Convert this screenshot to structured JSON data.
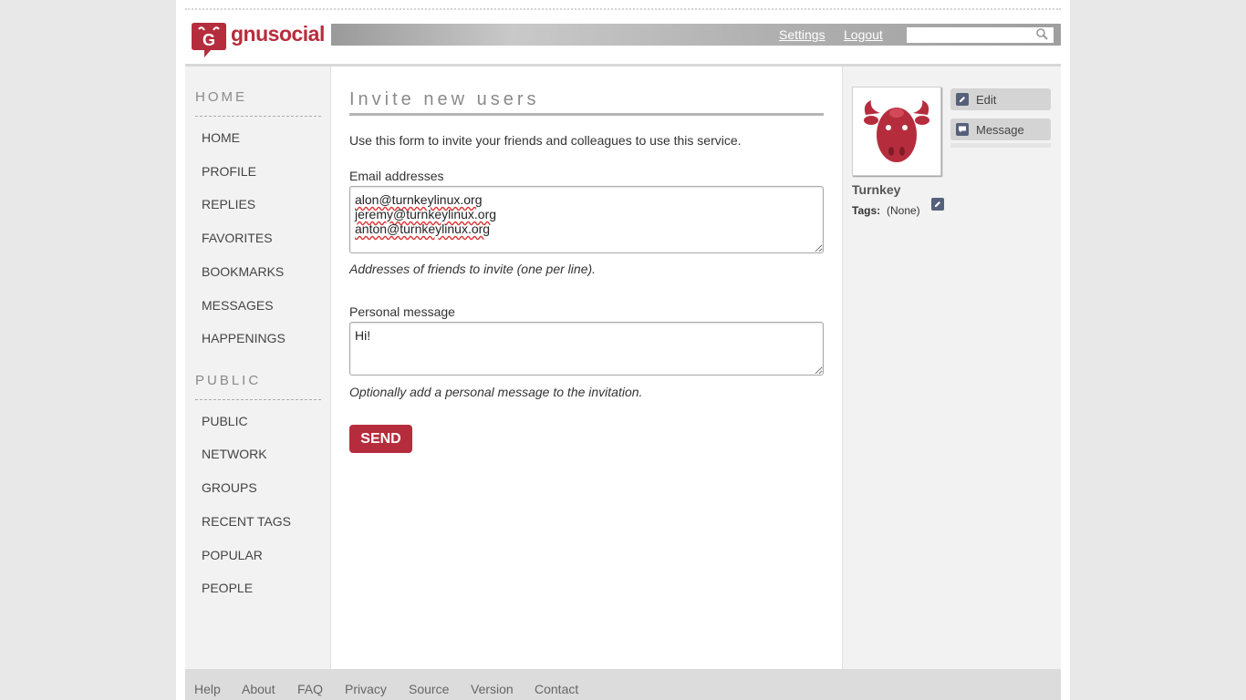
{
  "brand": {
    "logo_text": "gnusocial",
    "accent": "#b52d3d"
  },
  "header": {
    "settings_label": "Settings",
    "logout_label": "Logout",
    "search_placeholder": "",
    "search_icon": "magnifier-icon"
  },
  "sidebar": {
    "home_section": "HOME",
    "home_items": [
      "HOME",
      "PROFILE",
      "REPLIES",
      "FAVORITES",
      "BOOKMARKS",
      "MESSAGES",
      "HAPPENINGS"
    ],
    "public_section": "PUBLIC",
    "public_items": [
      "PUBLIC",
      "NETWORK",
      "GROUPS",
      "RECENT TAGS",
      "POPULAR",
      "PEOPLE"
    ]
  },
  "main": {
    "title": "Invite new users",
    "intro": "Use this form to invite your friends and colleagues to use this service.",
    "email_label": "Email addresses",
    "email_value": "alon@turnkeylinux.org\njeremy@turnkeylinux.org\nanton@turnkeylinux.org",
    "email_hint": "Addresses of friends to invite (one per line).",
    "message_label": "Personal message",
    "message_value": "Hi!",
    "message_hint": "Optionally add a personal message to the invitation.",
    "send_label": "SEND"
  },
  "profile": {
    "name": "Turnkey",
    "tags_label": "Tags:",
    "tags_value": "(None)",
    "actions": {
      "edit": "Edit",
      "message": "Message"
    }
  },
  "footer": {
    "links": [
      "Help",
      "About",
      "FAQ",
      "Privacy",
      "Source",
      "Version",
      "Contact"
    ]
  }
}
